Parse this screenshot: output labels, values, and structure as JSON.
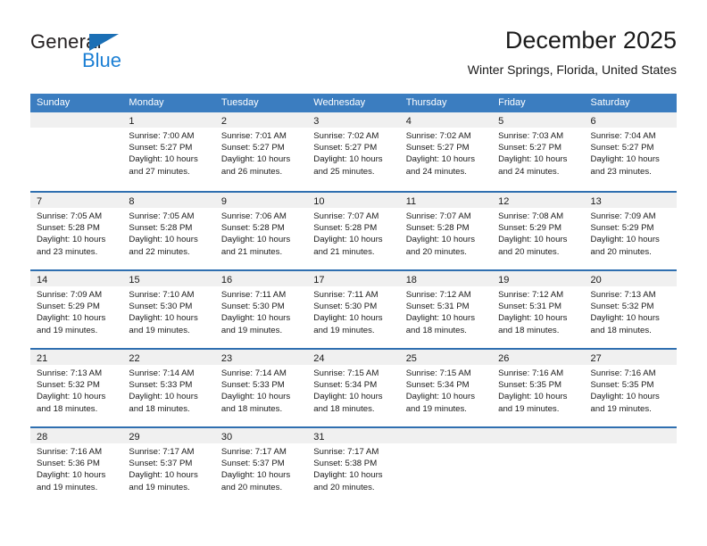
{
  "brand": {
    "name_part1": "General",
    "name_part2": "Blue",
    "triangle_color": "#1b6fb5",
    "blue_color": "#1b7fd4"
  },
  "header": {
    "title": "December 2025",
    "subtitle": "Winter Springs, Florida, United States"
  },
  "theme": {
    "header_bar_color": "#3b7dc0",
    "row_separator_color": "#2f6fb0",
    "day_band_color": "#f0f0f0"
  },
  "weekdays": [
    "Sunday",
    "Monday",
    "Tuesday",
    "Wednesday",
    "Thursday",
    "Friday",
    "Saturday"
  ],
  "weeks": [
    [
      {
        "day": "",
        "lines": []
      },
      {
        "day": "1",
        "lines": [
          "Sunrise: 7:00 AM",
          "Sunset: 5:27 PM",
          "Daylight: 10 hours",
          "and 27 minutes."
        ]
      },
      {
        "day": "2",
        "lines": [
          "Sunrise: 7:01 AM",
          "Sunset: 5:27 PM",
          "Daylight: 10 hours",
          "and 26 minutes."
        ]
      },
      {
        "day": "3",
        "lines": [
          "Sunrise: 7:02 AM",
          "Sunset: 5:27 PM",
          "Daylight: 10 hours",
          "and 25 minutes."
        ]
      },
      {
        "day": "4",
        "lines": [
          "Sunrise: 7:02 AM",
          "Sunset: 5:27 PM",
          "Daylight: 10 hours",
          "and 24 minutes."
        ]
      },
      {
        "day": "5",
        "lines": [
          "Sunrise: 7:03 AM",
          "Sunset: 5:27 PM",
          "Daylight: 10 hours",
          "and 24 minutes."
        ]
      },
      {
        "day": "6",
        "lines": [
          "Sunrise: 7:04 AM",
          "Sunset: 5:27 PM",
          "Daylight: 10 hours",
          "and 23 minutes."
        ]
      }
    ],
    [
      {
        "day": "7",
        "lines": [
          "Sunrise: 7:05 AM",
          "Sunset: 5:28 PM",
          "Daylight: 10 hours",
          "and 23 minutes."
        ]
      },
      {
        "day": "8",
        "lines": [
          "Sunrise: 7:05 AM",
          "Sunset: 5:28 PM",
          "Daylight: 10 hours",
          "and 22 minutes."
        ]
      },
      {
        "day": "9",
        "lines": [
          "Sunrise: 7:06 AM",
          "Sunset: 5:28 PM",
          "Daylight: 10 hours",
          "and 21 minutes."
        ]
      },
      {
        "day": "10",
        "lines": [
          "Sunrise: 7:07 AM",
          "Sunset: 5:28 PM",
          "Daylight: 10 hours",
          "and 21 minutes."
        ]
      },
      {
        "day": "11",
        "lines": [
          "Sunrise: 7:07 AM",
          "Sunset: 5:28 PM",
          "Daylight: 10 hours",
          "and 20 minutes."
        ]
      },
      {
        "day": "12",
        "lines": [
          "Sunrise: 7:08 AM",
          "Sunset: 5:29 PM",
          "Daylight: 10 hours",
          "and 20 minutes."
        ]
      },
      {
        "day": "13",
        "lines": [
          "Sunrise: 7:09 AM",
          "Sunset: 5:29 PM",
          "Daylight: 10 hours",
          "and 20 minutes."
        ]
      }
    ],
    [
      {
        "day": "14",
        "lines": [
          "Sunrise: 7:09 AM",
          "Sunset: 5:29 PM",
          "Daylight: 10 hours",
          "and 19 minutes."
        ]
      },
      {
        "day": "15",
        "lines": [
          "Sunrise: 7:10 AM",
          "Sunset: 5:30 PM",
          "Daylight: 10 hours",
          "and 19 minutes."
        ]
      },
      {
        "day": "16",
        "lines": [
          "Sunrise: 7:11 AM",
          "Sunset: 5:30 PM",
          "Daylight: 10 hours",
          "and 19 minutes."
        ]
      },
      {
        "day": "17",
        "lines": [
          "Sunrise: 7:11 AM",
          "Sunset: 5:30 PM",
          "Daylight: 10 hours",
          "and 19 minutes."
        ]
      },
      {
        "day": "18",
        "lines": [
          "Sunrise: 7:12 AM",
          "Sunset: 5:31 PM",
          "Daylight: 10 hours",
          "and 18 minutes."
        ]
      },
      {
        "day": "19",
        "lines": [
          "Sunrise: 7:12 AM",
          "Sunset: 5:31 PM",
          "Daylight: 10 hours",
          "and 18 minutes."
        ]
      },
      {
        "day": "20",
        "lines": [
          "Sunrise: 7:13 AM",
          "Sunset: 5:32 PM",
          "Daylight: 10 hours",
          "and 18 minutes."
        ]
      }
    ],
    [
      {
        "day": "21",
        "lines": [
          "Sunrise: 7:13 AM",
          "Sunset: 5:32 PM",
          "Daylight: 10 hours",
          "and 18 minutes."
        ]
      },
      {
        "day": "22",
        "lines": [
          "Sunrise: 7:14 AM",
          "Sunset: 5:33 PM",
          "Daylight: 10 hours",
          "and 18 minutes."
        ]
      },
      {
        "day": "23",
        "lines": [
          "Sunrise: 7:14 AM",
          "Sunset: 5:33 PM",
          "Daylight: 10 hours",
          "and 18 minutes."
        ]
      },
      {
        "day": "24",
        "lines": [
          "Sunrise: 7:15 AM",
          "Sunset: 5:34 PM",
          "Daylight: 10 hours",
          "and 18 minutes."
        ]
      },
      {
        "day": "25",
        "lines": [
          "Sunrise: 7:15 AM",
          "Sunset: 5:34 PM",
          "Daylight: 10 hours",
          "and 19 minutes."
        ]
      },
      {
        "day": "26",
        "lines": [
          "Sunrise: 7:16 AM",
          "Sunset: 5:35 PM",
          "Daylight: 10 hours",
          "and 19 minutes."
        ]
      },
      {
        "day": "27",
        "lines": [
          "Sunrise: 7:16 AM",
          "Sunset: 5:35 PM",
          "Daylight: 10 hours",
          "and 19 minutes."
        ]
      }
    ],
    [
      {
        "day": "28",
        "lines": [
          "Sunrise: 7:16 AM",
          "Sunset: 5:36 PM",
          "Daylight: 10 hours",
          "and 19 minutes."
        ]
      },
      {
        "day": "29",
        "lines": [
          "Sunrise: 7:17 AM",
          "Sunset: 5:37 PM",
          "Daylight: 10 hours",
          "and 19 minutes."
        ]
      },
      {
        "day": "30",
        "lines": [
          "Sunrise: 7:17 AM",
          "Sunset: 5:37 PM",
          "Daylight: 10 hours",
          "and 20 minutes."
        ]
      },
      {
        "day": "31",
        "lines": [
          "Sunrise: 7:17 AM",
          "Sunset: 5:38 PM",
          "Daylight: 10 hours",
          "and 20 minutes."
        ]
      },
      {
        "day": "",
        "lines": []
      },
      {
        "day": "",
        "lines": []
      },
      {
        "day": "",
        "lines": []
      }
    ]
  ]
}
